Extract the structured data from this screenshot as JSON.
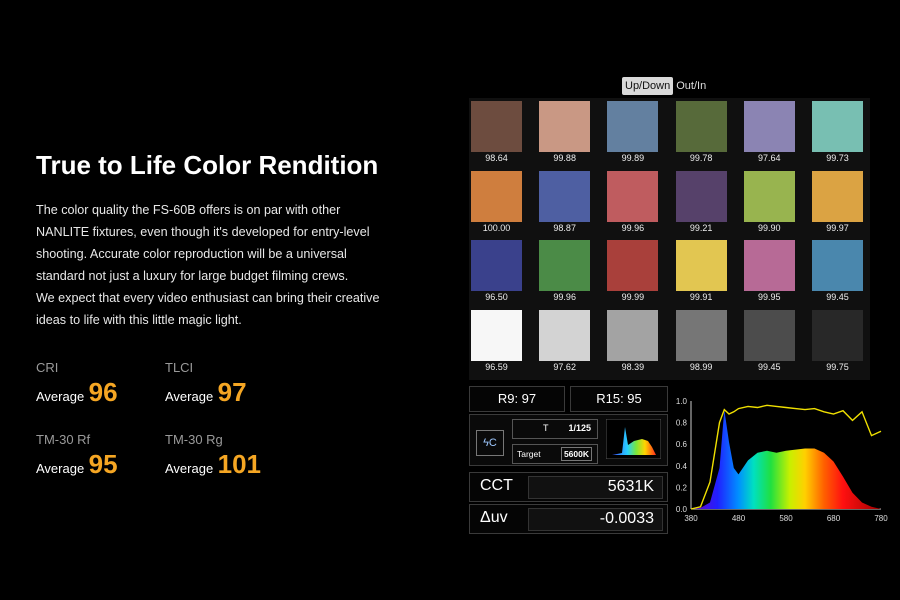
{
  "left": {
    "title": "True to Life Color Rendition",
    "description": [
      "The color quality the FS-60B offers is on par with other",
      "NANLITE fixtures, even though it's developed for entry-level",
      "shooting. Accurate color reproduction will be a universal",
      "standard not just a luxury for large budget filming crews.",
      "We expect that every video enthusiast can bring their creative",
      "ideas to life with this little magic light."
    ],
    "metrics": [
      {
        "label": "CRI",
        "avg_label": "Average",
        "value": "96"
      },
      {
        "label": "TLCI",
        "avg_label": "Average",
        "value": "97"
      },
      {
        "label": "TM-30 Rf",
        "avg_label": "Average",
        "value": "95"
      },
      {
        "label": "TM-30 Rg",
        "avg_label": "Average",
        "value": "101"
      }
    ]
  },
  "toggle": {
    "active": "Up/Down",
    "inactive": "Out/In"
  },
  "swatches": [
    {
      "color": "#6d4c3f",
      "value": "98.64"
    },
    {
      "color": "#c99884",
      "value": "99.88"
    },
    {
      "color": "#6380a0",
      "value": "99.89"
    },
    {
      "color": "#576a3a",
      "value": "99.78"
    },
    {
      "color": "#8b84b3",
      "value": "97.64"
    },
    {
      "color": "#78bfb2",
      "value": "99.73"
    },
    {
      "color": "#cf7e3e",
      "value": "100.00"
    },
    {
      "color": "#4e5fa2",
      "value": "98.87"
    },
    {
      "color": "#bf5c5f",
      "value": "99.96"
    },
    {
      "color": "#56416a",
      "value": "99.21"
    },
    {
      "color": "#98b44f",
      "value": "99.90"
    },
    {
      "color": "#dba343",
      "value": "99.97"
    },
    {
      "color": "#3a418c",
      "value": "96.50"
    },
    {
      "color": "#4b8b47",
      "value": "99.96"
    },
    {
      "color": "#a9403b",
      "value": "99.99"
    },
    {
      "color": "#e2c651",
      "value": "99.91"
    },
    {
      "color": "#b76a96",
      "value": "99.95"
    },
    {
      "color": "#4a87ad",
      "value": "99.45"
    },
    {
      "color": "#f7f7f7",
      "value": "96.59"
    },
    {
      "color": "#d3d3d3",
      "value": "97.62"
    },
    {
      "color": "#a3a3a3",
      "value": "98.39"
    },
    {
      "color": "#767676",
      "value": "98.99"
    },
    {
      "color": "#4c4c4c",
      "value": "99.45"
    },
    {
      "color": "#282828",
      "value": "99.75"
    }
  ],
  "meter": {
    "r9": "R9: 97",
    "r15": "R15: 95",
    "flash_icon": "auto-flash-icon",
    "flash_text": "ϟC",
    "t_label": "T",
    "t_value": "1/125",
    "target_label": "Target",
    "target_value": "5600K",
    "cct_label": "CCT",
    "cct_value": "5631K",
    "duv_label": "Δuv",
    "duv_value": "-0.0033"
  },
  "chart_data": {
    "type": "area",
    "x": [
      380,
      400,
      420,
      440,
      450,
      460,
      470,
      480,
      500,
      520,
      540,
      560,
      580,
      600,
      620,
      640,
      660,
      680,
      700,
      720,
      740,
      760,
      780
    ],
    "series": [
      {
        "values": [
          0.0,
          0.01,
          0.06,
          0.38,
          0.92,
          0.62,
          0.38,
          0.32,
          0.45,
          0.52,
          0.54,
          0.52,
          0.54,
          0.55,
          0.56,
          0.56,
          0.52,
          0.44,
          0.3,
          0.15,
          0.06,
          0.02,
          0.0
        ]
      },
      {
        "values": [
          0.0,
          0.02,
          0.25,
          0.8,
          0.92,
          0.88,
          0.9,
          0.93,
          0.95,
          0.94,
          0.96,
          0.95,
          0.94,
          0.93,
          0.92,
          0.93,
          0.9,
          0.88,
          0.91,
          0.82,
          0.9,
          0.68,
          0.72
        ]
      }
    ],
    "xlim": [
      380,
      780
    ],
    "ylim": [
      0.0,
      1.0
    ],
    "xticks": [
      "380",
      "480",
      "580",
      "680",
      "780"
    ],
    "yticks": [
      "0.0",
      "0.2",
      "0.4",
      "0.6",
      "0.8",
      "1.0"
    ],
    "colors": {
      "curve": "#f0e000",
      "axis": "#cccccc"
    }
  }
}
